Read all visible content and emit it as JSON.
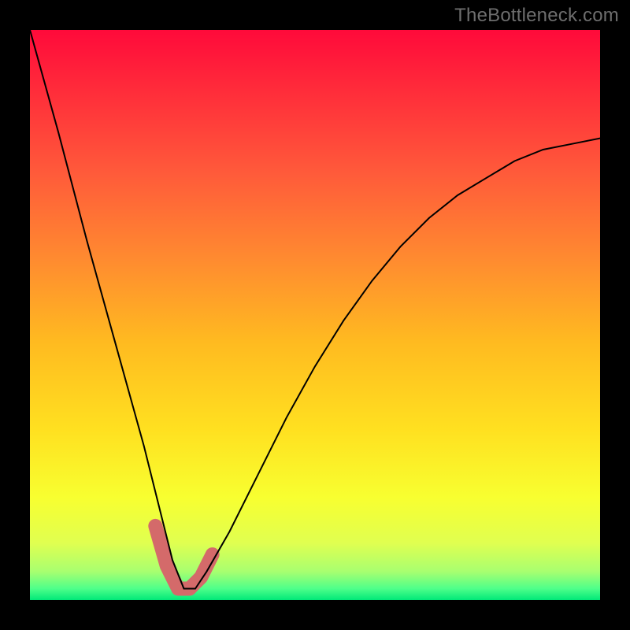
{
  "watermark": {
    "text": "TheBottleneck.com"
  },
  "colors": {
    "background": "#000000",
    "gradient_top": "#ff0a3a",
    "gradient_bottom": "#00e878",
    "curve": "#000000",
    "highlight": "#d46a6a"
  },
  "chart_data": {
    "type": "line",
    "title": "",
    "xlabel": "",
    "ylabel": "",
    "xlim": [
      0,
      1
    ],
    "ylim": [
      0,
      1
    ],
    "note": "No axes, ticks, or numeric labels are rendered; values are normalized 0–1. y=0 at bottom (green), y=1 at top (red). Curve is a V/checkmark shape with minimum near x≈0.27 and a short thick muted-red overlay around the trough.",
    "series": [
      {
        "name": "curve",
        "x": [
          0.0,
          0.05,
          0.1,
          0.15,
          0.2,
          0.23,
          0.25,
          0.27,
          0.29,
          0.31,
          0.35,
          0.4,
          0.45,
          0.5,
          0.55,
          0.6,
          0.65,
          0.7,
          0.75,
          0.8,
          0.85,
          0.9,
          0.95,
          1.0
        ],
        "y": [
          1.0,
          0.82,
          0.63,
          0.45,
          0.27,
          0.15,
          0.07,
          0.02,
          0.02,
          0.05,
          0.12,
          0.22,
          0.32,
          0.41,
          0.49,
          0.56,
          0.62,
          0.67,
          0.71,
          0.74,
          0.77,
          0.79,
          0.8,
          0.81
        ]
      },
      {
        "name": "highlight-segment",
        "x": [
          0.22,
          0.24,
          0.26,
          0.28,
          0.3,
          0.32
        ],
        "y": [
          0.13,
          0.06,
          0.02,
          0.02,
          0.04,
          0.08
        ]
      }
    ]
  }
}
